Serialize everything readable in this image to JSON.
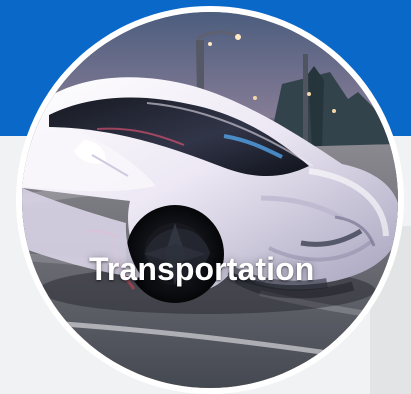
{
  "category": {
    "label": "Transportation"
  },
  "colors": {
    "banner": "#0a68c9",
    "background": "#f1f2f3",
    "right_panel": "#e3e4e6",
    "label": "#ffffff"
  }
}
